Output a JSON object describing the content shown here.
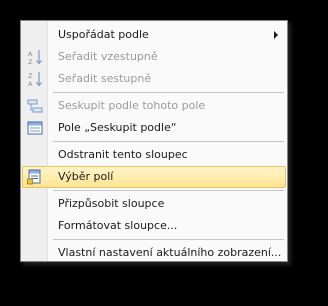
{
  "context_menu": {
    "items": [
      {
        "label": "Uspořádat podle",
        "enabled": true,
        "has_submenu": true,
        "icon": null
      },
      {
        "label": "Seřadit vzestupně",
        "enabled": false,
        "icon": "sort-ascending-icon"
      },
      {
        "label": "Seřadit sestupně",
        "enabled": false,
        "icon": "sort-descending-icon"
      },
      {
        "label": "Seskupit podle tohoto pole",
        "enabled": false,
        "icon": "group-by-field-icon"
      },
      {
        "label": "Pole „Seskupit podle“",
        "enabled": true,
        "icon": "group-by-box-icon"
      },
      {
        "label": "Odstranit tento sloupec",
        "enabled": true,
        "icon": null
      },
      {
        "label": "Výběr polí",
        "enabled": true,
        "highlighted": true,
        "icon": "field-chooser-icon"
      },
      {
        "label": "Přizpůsobit sloupce",
        "enabled": true,
        "icon": null
      },
      {
        "label": "Formátovat sloupce...",
        "enabled": true,
        "icon": null
      },
      {
        "label": "Vlastní nastavení aktuálního zobrazení...",
        "enabled": true,
        "icon": null
      }
    ]
  },
  "colors": {
    "menu_background": "#fafafa",
    "gutter": "#efefef",
    "highlight_fill": "#ffe493",
    "highlight_border": "#e8c35e",
    "disabled_text": "#9a9a9a"
  }
}
